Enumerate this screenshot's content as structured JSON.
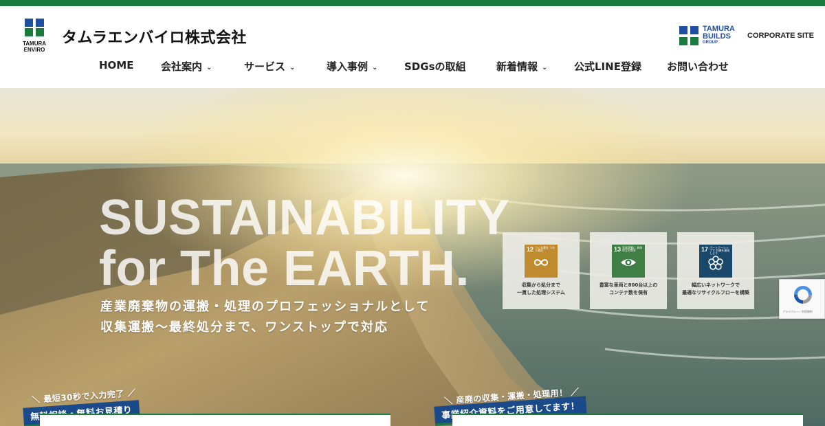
{
  "brand": {
    "mark_line1": "TAMURA",
    "mark_line2": "ENVIRO",
    "name": "タムラエンバイロ株式会社",
    "primary_color": "#1b7a3d",
    "secondary_color": "#1e4fa0"
  },
  "group": {
    "line1": "TAMURA",
    "line2": "BUILDS",
    "line3": "GROUP",
    "corporate_site": "CORPORATE SITE"
  },
  "nav": {
    "items": [
      {
        "label": "HOME",
        "has_dropdown": false
      },
      {
        "label": "会社案内",
        "has_dropdown": true
      },
      {
        "label": "サービス",
        "has_dropdown": true
      },
      {
        "label": "導入事例",
        "has_dropdown": true
      },
      {
        "label": "SDGsの取組",
        "has_dropdown": false
      },
      {
        "label": "新着情報",
        "has_dropdown": true
      },
      {
        "label": "公式LINE登録",
        "has_dropdown": false
      },
      {
        "label": "お問い合わせ",
        "has_dropdown": false
      }
    ],
    "chevron": "⌄"
  },
  "hero": {
    "title_line1": "SUSTAINABILITY",
    "title_line2": "for The EARTH.",
    "subtitle_line1": "産業廃棄物の運搬・処理のプロフェッショナルとして",
    "subtitle_line2": "収集運搬〜最終処分まで、ワンストップで対応"
  },
  "sdgs": [
    {
      "number": "12",
      "goal": "つくる責任 つかう責任",
      "icon": "infinity-icon",
      "color": "#bf8b2e",
      "text_line1": "収集から処分まで",
      "text_line2": "一貫した処理システム"
    },
    {
      "number": "13",
      "goal": "気候変動に 具体的な対策を",
      "icon": "eye-globe-icon",
      "color": "#3f7e44",
      "text_line1": "豊富な車両と800台以上の",
      "text_line2": "コンテナ数を保有"
    },
    {
      "number": "17",
      "goal": "パートナーシップで 目標を達成しよう",
      "icon": "flower-ring-icon",
      "color": "#19486a",
      "text_line1": "幅広いネットワークで",
      "text_line2": "最適なリサイクルフローを構築"
    }
  ],
  "recaptcha": {
    "text": "プライバシー・利用規約"
  },
  "cta": [
    {
      "note": "最短30秒で入力完了",
      "badge": "無料相談・無料お見積り"
    },
    {
      "note": "産廃の収集・運搬・処理用！",
      "badge": "事業紹介資料をご用意してます！"
    }
  ]
}
